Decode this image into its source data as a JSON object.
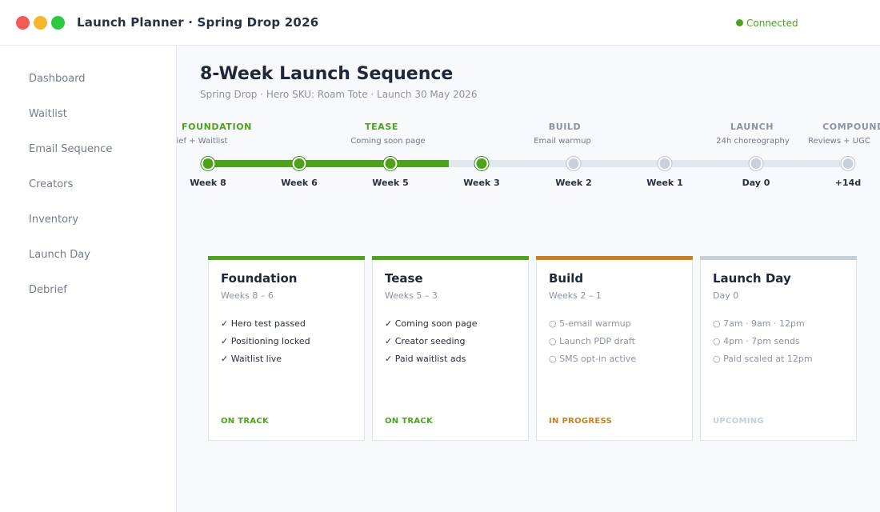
{
  "window": {
    "title": "Launch Planner · Spring Drop 2026",
    "status": "Connected",
    "colors": {
      "close": "#f15b57",
      "minimize": "#f7b52c",
      "zoom": "#2bc840",
      "accent": "#4ea11a",
      "warning": "#c8821f",
      "muted": "#c5cedb"
    }
  },
  "sidebar": {
    "items": [
      {
        "label": "Dashboard",
        "active": true
      },
      {
        "label": "Waitlist",
        "active": false
      },
      {
        "label": "Email Sequence",
        "active": false
      },
      {
        "label": "Creators",
        "active": false
      },
      {
        "label": "Inventory",
        "active": false
      },
      {
        "label": "Launch Day",
        "active": false
      },
      {
        "label": "Debrief",
        "active": false
      }
    ]
  },
  "main": {
    "title": "8-Week Launch Sequence",
    "subtitle": "Spring Drop · Hero SKU: Roam Tote · Launch 30 May 2026"
  },
  "timeline": {
    "phases": [
      {
        "name": "FOUNDATION",
        "desc": "Brief + Waitlist",
        "state": "done"
      },
      {
        "name": "TEASE",
        "desc": "Coming soon page",
        "state": "done"
      },
      {
        "name": "BUILD",
        "desc": "Email warmup",
        "state": "todo"
      },
      {
        "name": "LAUNCH",
        "desc": "24h choreography",
        "state": "todo"
      },
      {
        "name": "COMPOUND",
        "desc": "Reviews + UGC",
        "state": "todo"
      }
    ],
    "milestones": [
      {
        "label": "Week 8",
        "done": true
      },
      {
        "label": "Week 6",
        "done": true
      },
      {
        "label": "Week 5",
        "done": true
      },
      {
        "label": "Week 3",
        "done": true
      },
      {
        "label": "Week 2",
        "done": false
      },
      {
        "label": "Week 1",
        "done": false
      },
      {
        "label": "Day 0",
        "done": false
      },
      {
        "label": "+14d",
        "done": false
      }
    ]
  },
  "cards": [
    {
      "title": "Foundation",
      "range": "Weeks 8 – 6",
      "items": [
        {
          "text": "✓ Hero test passed",
          "done": true
        },
        {
          "text": "✓ Positioning locked",
          "done": true
        },
        {
          "text": "✓ Waitlist live",
          "done": true
        }
      ],
      "status": "ON TRACK",
      "color": "#4ea11a"
    },
    {
      "title": "Tease",
      "range": "Weeks 5 – 3",
      "items": [
        {
          "text": "✓ Coming soon page",
          "done": true
        },
        {
          "text": "✓ Creator seeding",
          "done": true
        },
        {
          "text": "✓ Paid waitlist ads",
          "done": true
        }
      ],
      "status": "ON TRACK",
      "color": "#4ea11a"
    },
    {
      "title": "Build",
      "range": "Weeks 2 – 1",
      "items": [
        {
          "text": "○ 5-email warmup",
          "done": false
        },
        {
          "text": "○ Launch PDP draft",
          "done": false
        },
        {
          "text": "○ SMS opt-in active",
          "done": false
        }
      ],
      "status": "IN PROGRESS",
      "color": "#c8821f"
    },
    {
      "title": "Launch Day",
      "range": "Day 0",
      "items": [
        {
          "text": "○ 7am · 9am · 12pm",
          "done": false
        },
        {
          "text": "○ 4pm · 7pm sends",
          "done": false
        },
        {
          "text": "○ Paid scaled at 12pm",
          "done": false
        }
      ],
      "status": "UPCOMING",
      "color": "#c5cedb"
    }
  ]
}
